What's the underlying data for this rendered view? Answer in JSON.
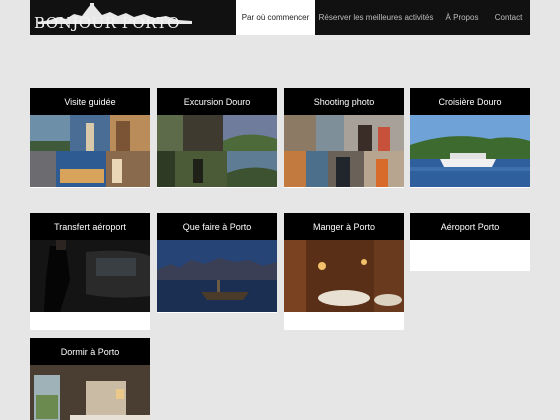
{
  "header": {
    "logo_text": "BONJOUR PORTO",
    "nav": [
      {
        "label": "Par où commencer"
      },
      {
        "label": "Réserver les meilleures activités"
      },
      {
        "label": "À Propos"
      },
      {
        "label": "Contact"
      }
    ]
  },
  "cards": [
    {
      "title": "Visite guidée"
    },
    {
      "title": "Excursion Douro"
    },
    {
      "title": "Shooting photo"
    },
    {
      "title": "Croisière Douro"
    },
    {
      "title": "Transfert aéroport"
    },
    {
      "title": "Que faire à Porto"
    },
    {
      "title": "Manger à Porto"
    },
    {
      "title": "Aéroport Porto"
    },
    {
      "title": "Dormir à Porto"
    }
  ],
  "colors": {
    "page_background": "#e6e6e6",
    "header_background": "#111111",
    "card_title_background": "#000000",
    "active_nav_background": "#ffffff"
  }
}
